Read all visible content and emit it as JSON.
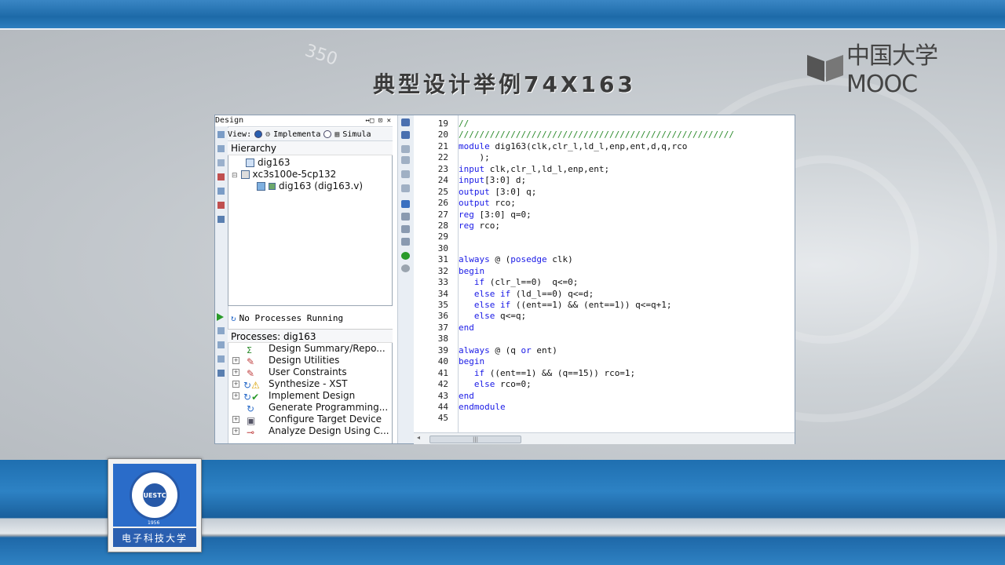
{
  "slide": {
    "title": "典型设计举例74X163",
    "mooc_text": "中国大学MOOC",
    "deco_number": "350",
    "university_name": "电子科技大学",
    "logo_core": "UESTC",
    "logo_year": "1956"
  },
  "ide": {
    "design_panel_title": "Design",
    "design_panel_controls": "↔□ ⊡ ✕",
    "view_label": "View:",
    "view_option_implementation": "Implementa",
    "view_option_simulation": "Simula",
    "hierarchy_header": "Hierarchy",
    "hierarchy": [
      {
        "label": "dig163"
      },
      {
        "label": "xc3s100e-5cp132"
      },
      {
        "label": "dig163 (dig163.v)"
      }
    ],
    "process_status": "No Processes Running",
    "processes_header": "Processes: dig163",
    "processes": [
      {
        "label": "Design Summary/Repo...",
        "expandable": false
      },
      {
        "label": "Design Utilities",
        "expandable": true
      },
      {
        "label": "User Constraints",
        "expandable": true
      },
      {
        "label": "Synthesize - XST",
        "expandable": true
      },
      {
        "label": "Implement Design",
        "expandable": true
      },
      {
        "label": "Generate Programming...",
        "expandable": false
      },
      {
        "label": "Configure Target Device",
        "expandable": true
      },
      {
        "label": "Analyze Design Using C...",
        "expandable": true
      }
    ],
    "scrollbar_grip": "|||",
    "code_lines": [
      {
        "n": "19",
        "parts": [
          [
            "cm",
            "//"
          ]
        ]
      },
      {
        "n": "20",
        "parts": [
          [
            "cm",
            "/////////////////////////////////////////////////////"
          ]
        ]
      },
      {
        "n": "21",
        "parts": [
          [
            "kw",
            "module"
          ],
          [
            "tx",
            " dig163(clk,clr_l,ld_l,enp,ent,d,q,rco"
          ]
        ]
      },
      {
        "n": "22",
        "parts": [
          [
            "tx",
            "    );"
          ]
        ]
      },
      {
        "n": "23",
        "parts": [
          [
            "kw",
            "input"
          ],
          [
            "tx",
            " clk,clr_l,ld_l,enp,ent;"
          ]
        ]
      },
      {
        "n": "24",
        "parts": [
          [
            "kw",
            "input"
          ],
          [
            "tx",
            "[3:0] d;"
          ]
        ]
      },
      {
        "n": "25",
        "parts": [
          [
            "kw",
            "output"
          ],
          [
            "tx",
            " [3:0] q;"
          ]
        ]
      },
      {
        "n": "26",
        "parts": [
          [
            "kw",
            "output"
          ],
          [
            "tx",
            " rco;"
          ]
        ]
      },
      {
        "n": "27",
        "parts": [
          [
            "kw",
            "reg"
          ],
          [
            "tx",
            " [3:0] q=0;"
          ]
        ]
      },
      {
        "n": "28",
        "parts": [
          [
            "kw",
            "reg"
          ],
          [
            "tx",
            " rco;"
          ]
        ]
      },
      {
        "n": "29",
        "parts": []
      },
      {
        "n": "30",
        "parts": []
      },
      {
        "n": "31",
        "parts": [
          [
            "kw",
            "always"
          ],
          [
            "tx",
            " @ ("
          ],
          [
            "kw",
            "posedge"
          ],
          [
            "tx",
            " clk)"
          ]
        ]
      },
      {
        "n": "32",
        "parts": [
          [
            "kw",
            "begin"
          ]
        ]
      },
      {
        "n": "33",
        "parts": [
          [
            "tx",
            "   "
          ],
          [
            "kw",
            "if"
          ],
          [
            "tx",
            " (clr_l==0)  q<=0;"
          ]
        ]
      },
      {
        "n": "34",
        "parts": [
          [
            "tx",
            "   "
          ],
          [
            "kw",
            "else if"
          ],
          [
            "tx",
            " (ld_l==0) q<=d;"
          ]
        ]
      },
      {
        "n": "35",
        "parts": [
          [
            "tx",
            "   "
          ],
          [
            "kw",
            "else if"
          ],
          [
            "tx",
            " ((ent==1) && (ent==1)) q<=q+1;"
          ]
        ]
      },
      {
        "n": "36",
        "parts": [
          [
            "tx",
            "   "
          ],
          [
            "kw",
            "else"
          ],
          [
            "tx",
            " q<=q;"
          ]
        ]
      },
      {
        "n": "37",
        "parts": [
          [
            "kw",
            "end"
          ]
        ]
      },
      {
        "n": "38",
        "parts": []
      },
      {
        "n": "39",
        "parts": [
          [
            "kw",
            "always"
          ],
          [
            "tx",
            " @ (q "
          ],
          [
            "kw",
            "or"
          ],
          [
            "tx",
            " ent)"
          ]
        ]
      },
      {
        "n": "40",
        "parts": [
          [
            "kw",
            "begin"
          ]
        ]
      },
      {
        "n": "41",
        "parts": [
          [
            "tx",
            "   "
          ],
          [
            "kw",
            "if"
          ],
          [
            "tx",
            " ((ent==1) && (q==15)) rco=1;"
          ]
        ]
      },
      {
        "n": "42",
        "parts": [
          [
            "tx",
            "   "
          ],
          [
            "kw",
            "else"
          ],
          [
            "tx",
            " rco=0;"
          ]
        ]
      },
      {
        "n": "43",
        "parts": [
          [
            "kw",
            "end"
          ]
        ]
      },
      {
        "n": "44",
        "parts": [
          [
            "kw",
            "endmodule"
          ]
        ]
      },
      {
        "n": "45",
        "parts": []
      }
    ]
  },
  "colors": {
    "keyword": "#1a1ae6",
    "comment": "#2a8a2a",
    "brand_blue": "#1f6fb0"
  }
}
